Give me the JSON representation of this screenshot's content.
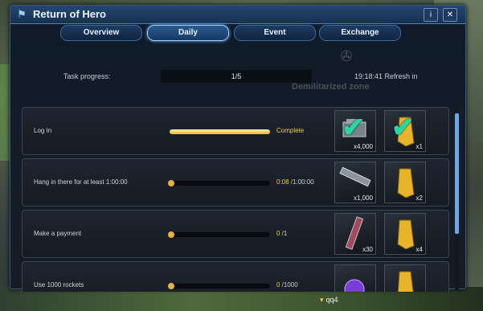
{
  "window": {
    "title": "Return of Hero",
    "info_label": "i",
    "close_label": "✕"
  },
  "tabs": [
    {
      "label": "Overview",
      "active": false
    },
    {
      "label": "Daily",
      "active": true
    },
    {
      "label": "Event",
      "active": false
    },
    {
      "label": "Exchange",
      "active": false
    }
  ],
  "progress": {
    "label": "Task progress:",
    "value": "1/5",
    "refresh": "19:18:41 Refresh in"
  },
  "background": {
    "zone_text": "Demilitarized zone",
    "player_name": "qq4"
  },
  "tasks": [
    {
      "label": "Log In",
      "progress": 1.0,
      "status_complete": "Complete",
      "status_current": "",
      "status_total": "",
      "rewards": [
        {
          "icon": "ore-chunk-icon",
          "qty": "x4,000",
          "claimed": true
        },
        {
          "icon": "gold-ticket-icon",
          "qty": "x1",
          "claimed": true
        }
      ]
    },
    {
      "label": "Hang in there for at least 1:00:00",
      "progress": 0.0,
      "status_complete": "",
      "status_current": "0:08",
      "status_total": " /1:00:00",
      "rewards": [
        {
          "icon": "laser-cannon-icon",
          "qty": "x1,000",
          "claimed": false
        },
        {
          "icon": "gold-ticket-icon",
          "qty": "x2",
          "claimed": false
        }
      ]
    },
    {
      "label": "Make a payment",
      "progress": 0.0,
      "status_complete": "",
      "status_current": "0",
      "status_total": " /1",
      "rewards": [
        {
          "icon": "rocket-launcher-icon",
          "qty": "x30",
          "claimed": false
        },
        {
          "icon": "gold-ticket-icon",
          "qty": "x4",
          "claimed": false
        }
      ]
    },
    {
      "label": "Use 1000 rockets",
      "progress": 0.0,
      "status_complete": "",
      "status_current": "0",
      "status_total": " /1000",
      "rewards": [
        {
          "icon": "energy-orb-icon",
          "qty": "",
          "claimed": false
        },
        {
          "icon": "gold-ticket-icon",
          "qty": "",
          "claimed": false
        }
      ]
    }
  ],
  "colors": {
    "accent": "#6ea6e8",
    "gold": "#f2c94c",
    "check": "#27d9a0"
  }
}
